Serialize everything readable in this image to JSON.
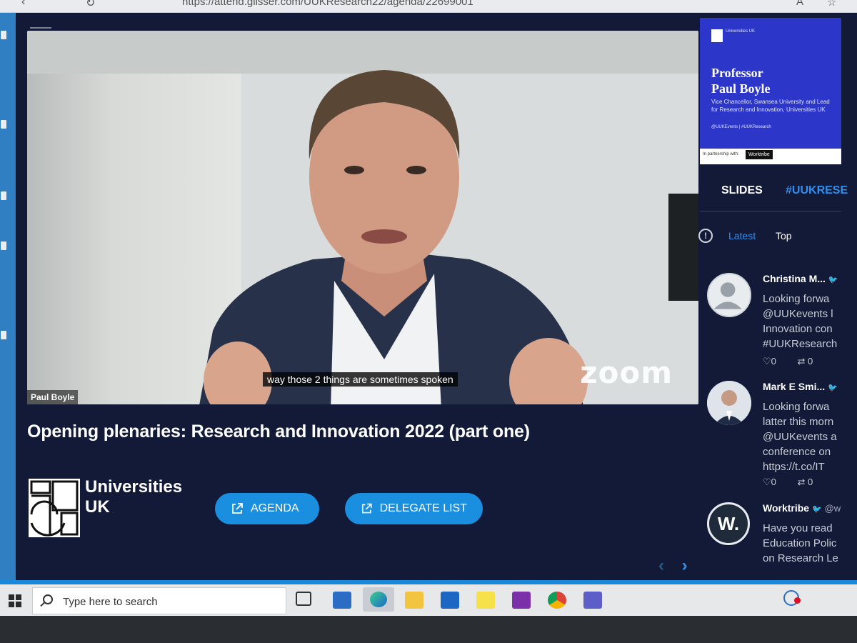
{
  "browser": {
    "url": "https://attend.glisser.com/UUKResearch22/agenda/22699001",
    "reader_icon": "reader-view-icon",
    "favorites_icon": "favorites-icon"
  },
  "video": {
    "caption": "way those 2 things are sometimes spoken",
    "zoom_watermark": "zoom",
    "speaker_tag": "Paul Boyle"
  },
  "session": {
    "title": "Opening plenaries: Research and Innovation 2022 (part one)"
  },
  "organisation": {
    "name_line1": "Universities",
    "name_line2": "UK"
  },
  "buttons": {
    "agenda": "AGENDA",
    "delegate_list": "DELEGATE LIST"
  },
  "slide": {
    "org": "Universities UK",
    "speaker_line1": "Professor",
    "speaker_line2": "Paul Boyle",
    "role": "Vice Chancellor, Swansea University and Lead for Research and Innovation, Universities UK",
    "social": "@UUKEvents  |  #UUKResearch",
    "partner_label": "In partnership with:",
    "partner_name": "Worktribe"
  },
  "tabs": {
    "slides": "SLIDES",
    "hashtag": "#UUKRESE"
  },
  "feed_filter": {
    "latest": "Latest",
    "top": "Top"
  },
  "tweets": [
    {
      "author": "Christina M...",
      "handle": "",
      "lines": [
        "Looking forwa",
        "@UUKevents l",
        "Innovation con",
        "#UUKResearch"
      ],
      "likes": "0",
      "retweets": "0"
    },
    {
      "author": "Mark E Smi...",
      "handle": "",
      "lines": [
        "Looking forwa",
        "latter this morn",
        "@UUKevents a",
        "conference on",
        "https://t.co/IT"
      ],
      "likes": "0",
      "retweets": "0"
    },
    {
      "author": "Worktribe",
      "handle": "@w",
      "avatar_letter": "W.",
      "lines": [
        "Have you read",
        "Education Polic",
        "on Research Le"
      ]
    }
  ],
  "taskbar": {
    "search_placeholder": "Type here to search"
  },
  "colors": {
    "page_bg": "#121a38",
    "accent_blue": "#1a8fe0",
    "slide_blue": "#2c36c9"
  }
}
